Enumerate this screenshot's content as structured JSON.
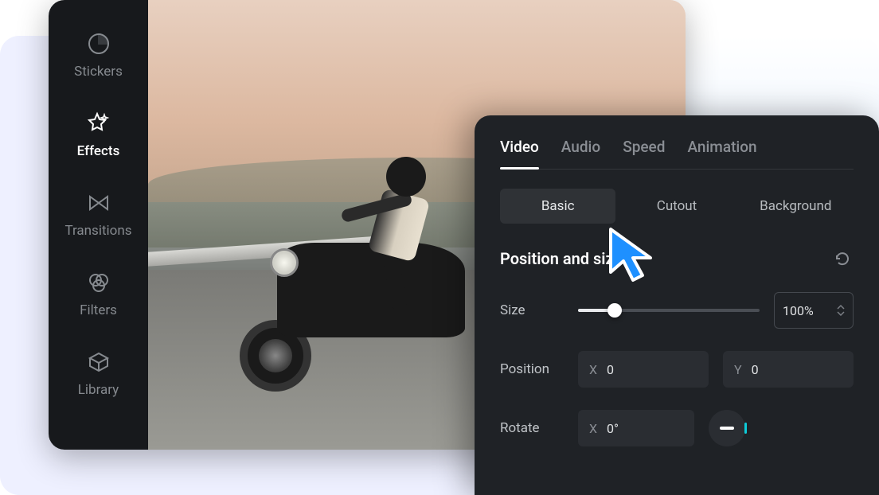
{
  "sidebar": {
    "items": [
      {
        "label": "Stickers"
      },
      {
        "label": "Effects"
      },
      {
        "label": "Transitions"
      },
      {
        "label": "Filters"
      },
      {
        "label": "Library"
      }
    ]
  },
  "properties": {
    "tabs": [
      {
        "label": "Video"
      },
      {
        "label": "Audio"
      },
      {
        "label": "Speed"
      },
      {
        "label": "Animation"
      }
    ],
    "subtabs": [
      {
        "label": "Basic"
      },
      {
        "label": "Cutout"
      },
      {
        "label": "Background"
      }
    ],
    "section_title": "Position and size",
    "size": {
      "label": "Size",
      "value": "100%"
    },
    "position": {
      "label": "Position",
      "x_prefix": "X",
      "x_value": "0",
      "y_prefix": "Y",
      "y_value": "0"
    },
    "rotate": {
      "label": "Rotate",
      "x_prefix": "X",
      "x_value": "0°"
    }
  }
}
